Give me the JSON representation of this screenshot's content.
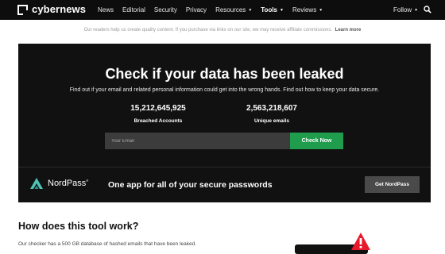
{
  "nav": {
    "brand": "cybernews",
    "items": [
      {
        "label": "News",
        "dropdown": false,
        "bold": false
      },
      {
        "label": "Editorial",
        "dropdown": false,
        "bold": false
      },
      {
        "label": "Security",
        "dropdown": false,
        "bold": false
      },
      {
        "label": "Privacy",
        "dropdown": false,
        "bold": false
      },
      {
        "label": "Resources",
        "dropdown": true,
        "bold": false
      },
      {
        "label": "Tools",
        "dropdown": true,
        "bold": true
      },
      {
        "label": "Reviews",
        "dropdown": true,
        "bold": false
      }
    ],
    "follow": "Follow",
    "search_icon": "search-icon"
  },
  "notice": {
    "text": "Our readers help us create quality content. If you purchase via links on our site, we may receive affiliate commissions.",
    "link": "Learn more"
  },
  "hero": {
    "title": "Check if your data has been leaked",
    "subtitle": "Find out if your email and related personal information could get into the wrong hands. Find out how to keep your data secure.",
    "stats": [
      {
        "value": "15,212,645,925",
        "label": "Breached Accounts"
      },
      {
        "value": "2,563,218,607",
        "label": "Unique emails"
      }
    ],
    "input_placeholder": "Your Email",
    "button": "Check Now",
    "button_color": "#1f9d4d"
  },
  "promo": {
    "brand": "NordPass",
    "tm": "®",
    "tagline": "One app for all of your secure passwords",
    "button": "Get NordPass",
    "brand_color": "#4fc3b5"
  },
  "section": {
    "title": "How does this tool work?",
    "text": "Our checker has a 500 GB database of hashed emails that have been leaked.",
    "warning_color": "#e8192c"
  }
}
